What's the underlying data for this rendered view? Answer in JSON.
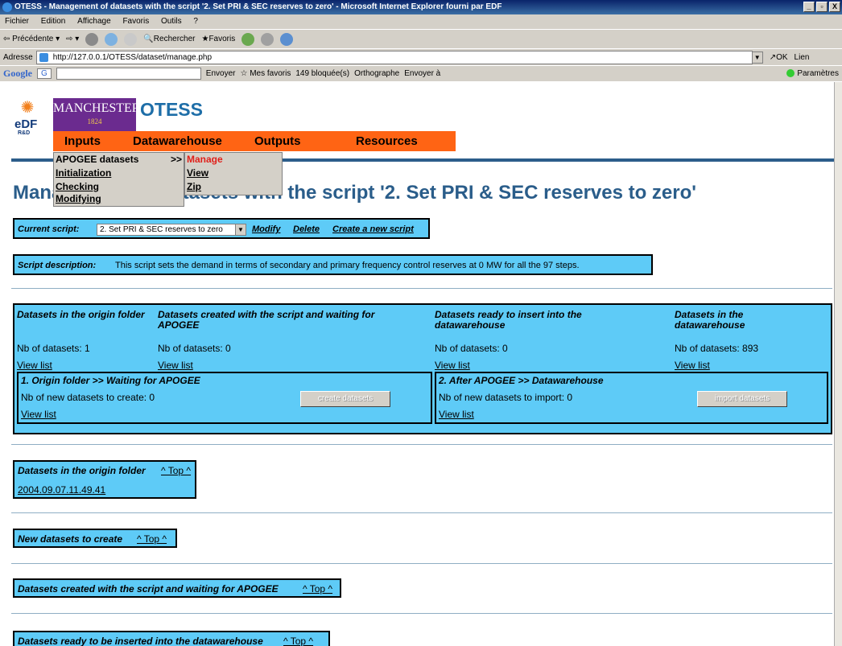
{
  "window": {
    "title": "OTESS - Management of datasets with the script '2. Set PRI & SEC reserves to zero' - Microsoft Internet Explorer fourni par EDF",
    "min": "_",
    "max": "̸",
    "close": "X"
  },
  "menubar": [
    "Fichier",
    "Edition",
    "Affichage",
    "Favoris",
    "Outils",
    "?"
  ],
  "toolbar": {
    "back": "Précédente",
    "search": "Rechercher",
    "favorites": "Favoris"
  },
  "address": {
    "label": "Adresse",
    "url": "http://127.0.0.1/OTESS/dataset/manage.php",
    "go": "OK",
    "links": "Lien"
  },
  "googlebar": {
    "logo": "Google",
    "g": "G",
    "send": "Envoyer",
    "fav": "Mes favoris",
    "blocked": "149 bloquée(s)",
    "spell": "Orthographe",
    "sendto": "Envoyer à",
    "params": "Paramètres"
  },
  "logos": {
    "edf": "eDF",
    "rd": "R&D",
    "manchester": "MANCHESTER",
    "year": "1824",
    "otess": "OTESS"
  },
  "nav": [
    "Inputs",
    "Datawarehouse",
    "Outputs",
    "Resources"
  ],
  "inputs_menu": {
    "items": [
      "APOGEE datasets",
      "Initialization",
      "Checking",
      "Modifying"
    ],
    "arrow": ">>"
  },
  "apogee_menu": {
    "items": [
      "Manage",
      "View",
      "Zip"
    ]
  },
  "headline": "Management of datasets with the script '2. Set PRI & SEC reserves to zero'",
  "current_script": {
    "label": "Current script:",
    "value": "2. Set PRI & SEC reserves to zero",
    "modify": "Modify",
    "delete": "Delete",
    "create": "Create a new script"
  },
  "description": {
    "label": "Script description:",
    "text": "This script sets the demand in terms of secondary and primary frequency control reserves at 0 MW for all the 97 steps."
  },
  "summary": {
    "columns": [
      {
        "title": "Datasets in the origin folder",
        "count": "Nb of datasets: 1",
        "link": "View list"
      },
      {
        "title": "Datasets created with the script and waiting for APOGEE",
        "count": "Nb of datasets: 0",
        "link": "View list"
      },
      {
        "title": "Datasets ready to insert into the datawarehouse",
        "count": "Nb of datasets: 0",
        "link": "View list"
      },
      {
        "title": "Datasets in the datawarehouse",
        "count": "Nb of datasets: 893",
        "link": "View list"
      }
    ],
    "step1": {
      "title": "1. Origin folder >> Waiting for APOGEE",
      "count": "Nb of new datasets to create: 0",
      "button": "create datasets",
      "link": "View list"
    },
    "step2": {
      "title": "2. After APOGEE >> Datawarehouse",
      "count": "Nb of new datasets to import: 0",
      "button": "import datasets",
      "link": "View list"
    }
  },
  "sections": {
    "origin": {
      "title": "Datasets in the origin folder",
      "top": "^ Top ^",
      "item": "2004.09.07.11.49.41"
    },
    "newsets": {
      "title": "New datasets to create",
      "top": "^ Top ^"
    },
    "waiting": {
      "title": "Datasets created with the script and waiting for APOGEE",
      "top": "^ Top ^"
    },
    "ready": {
      "title": "Datasets ready to be inserted into the datawarehouse",
      "top": "^ Top ^"
    }
  }
}
